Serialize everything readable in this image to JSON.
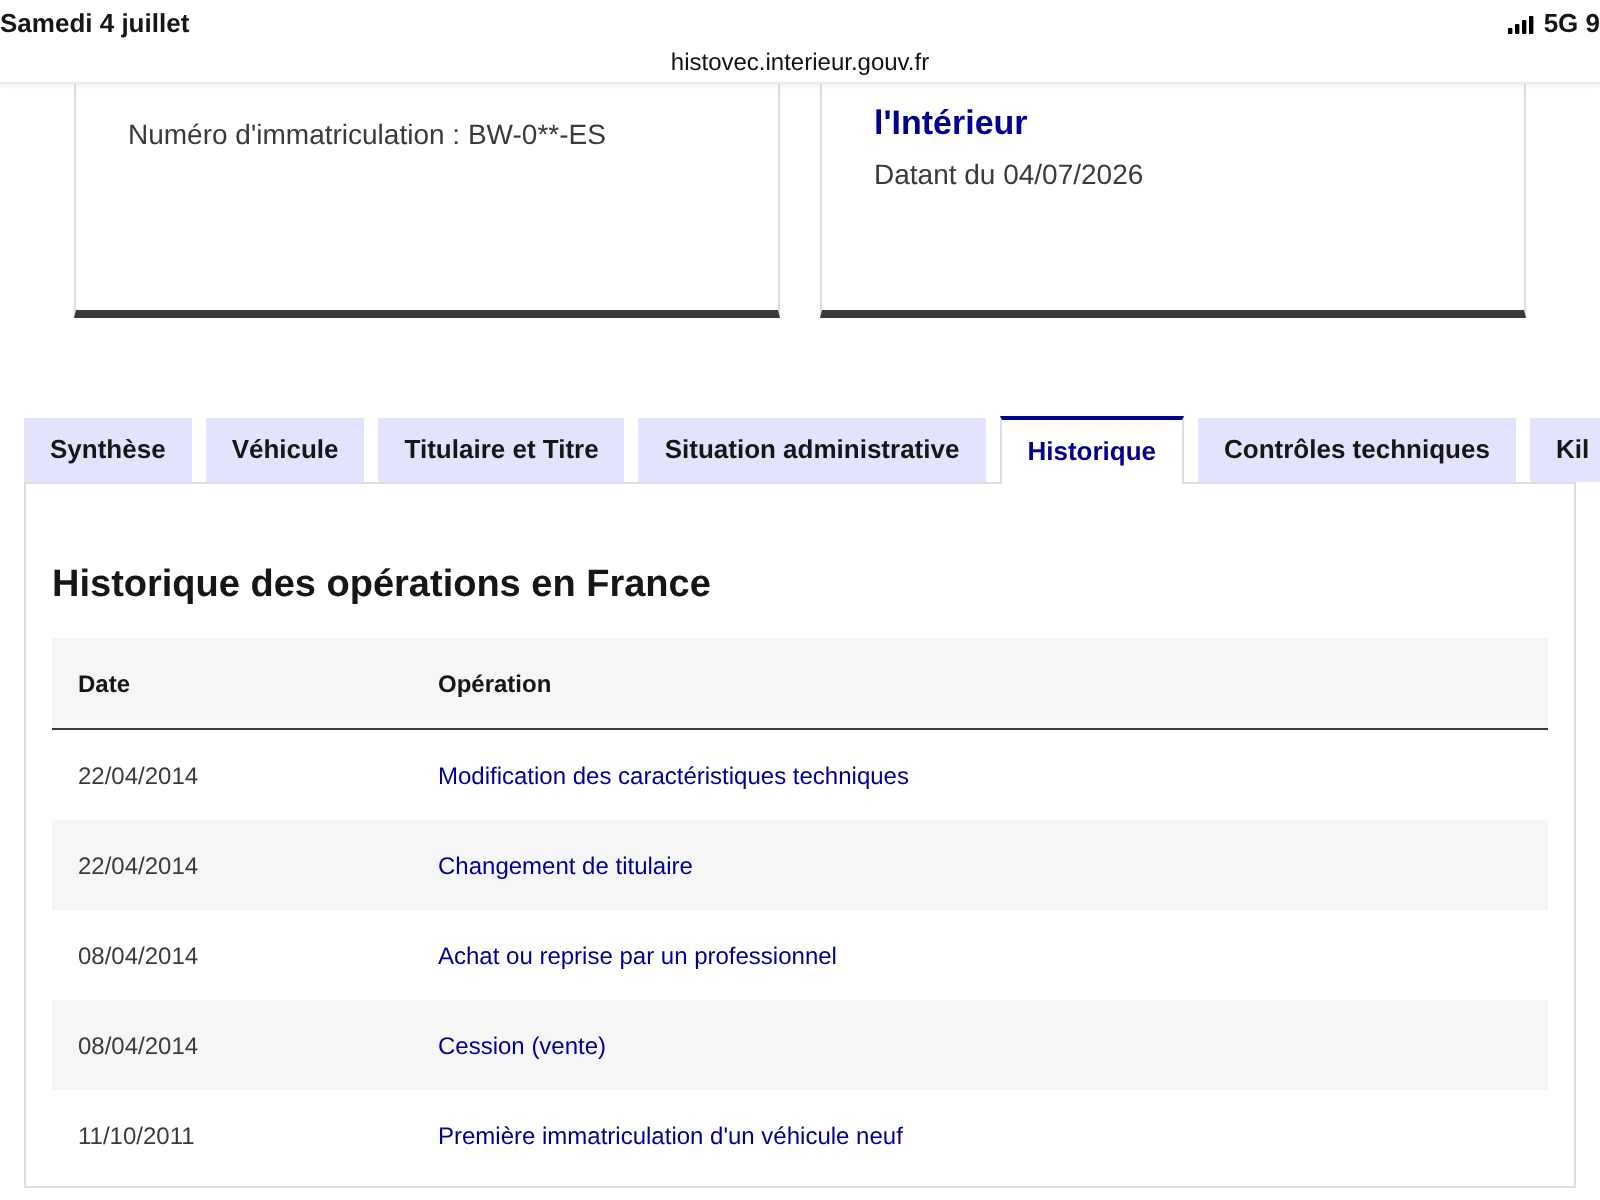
{
  "status_bar": {
    "date": "Samedi 4 juillet",
    "network": "5G 9"
  },
  "address_bar": {
    "url": "histovec.interieur.gouv.fr"
  },
  "cards": [
    {
      "description": "Numéro d'immatriculation : BW-0**-ES"
    },
    {
      "title": "l'Intérieur",
      "description": "Datant du 04/07/2026"
    }
  ],
  "tabs": [
    {
      "label": "Synthèse",
      "selected": false
    },
    {
      "label": "Véhicule",
      "selected": false
    },
    {
      "label": "Titulaire et Titre",
      "selected": false
    },
    {
      "label": "Situation administrative",
      "selected": false
    },
    {
      "label": "Historique",
      "selected": true
    },
    {
      "label": "Contrôles techniques",
      "selected": false
    },
    {
      "label": "Kil",
      "selected": false
    }
  ],
  "history": {
    "title": "Historique des opérations en France",
    "columns": [
      "Date",
      "Opération"
    ],
    "rows": [
      {
        "date": "22/04/2014",
        "operation": "Modification des caractéristiques techniques"
      },
      {
        "date": "22/04/2014",
        "operation": "Changement de titulaire"
      },
      {
        "date": "08/04/2014",
        "operation": "Achat ou reprise par un professionnel"
      },
      {
        "date": "08/04/2014",
        "operation": "Cession (vente)"
      },
      {
        "date": "11/10/2011",
        "operation": "Première immatriculation d'un véhicule neuf"
      }
    ]
  }
}
